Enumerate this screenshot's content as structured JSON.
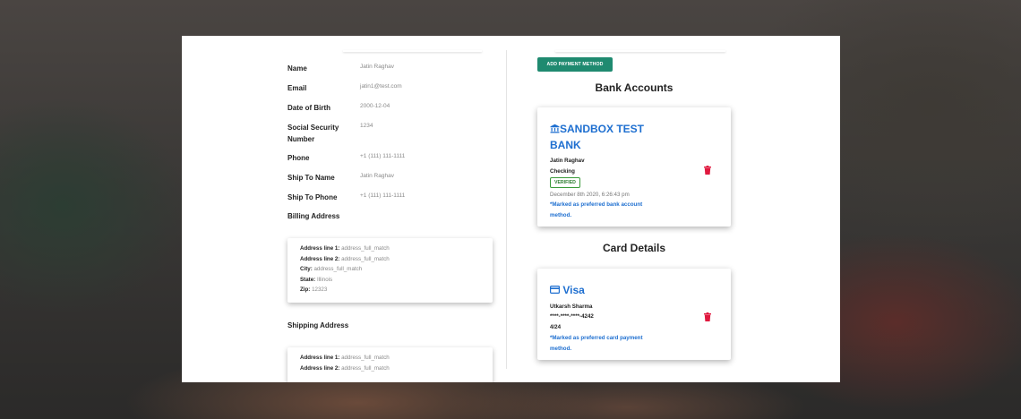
{
  "profile": {
    "fields": [
      {
        "label": "Name",
        "value": "Jatin Raghav"
      },
      {
        "label": "Email",
        "value": "jatin1@test.com"
      },
      {
        "label": "Date of Birth",
        "value": "2000-12-04"
      },
      {
        "label": "Social Security Number",
        "value": "1234"
      },
      {
        "label": "Phone",
        "value": "+1 (111) 111-1111"
      },
      {
        "label": "Ship To Name",
        "value": "Jatin Raghav"
      },
      {
        "label": "Ship To Phone",
        "value": "+1 (111) 111-1111"
      }
    ],
    "billing_label": "Billing Address",
    "billing": {
      "line1_label": "Address line 1:",
      "line1": "address_full_match",
      "line2_label": "Address line 2:",
      "line2": "address_full_match",
      "city_label": "City:",
      "city": "address_full_match",
      "state_label": "State:",
      "state": "Illinois",
      "zip_label": "Zip:",
      "zip": "12323"
    },
    "shipping_label": "Shipping Address",
    "shipping": {
      "line1_label": "Address line 1:",
      "line1": "address_full_match",
      "line2_label": "Address line 2:",
      "line2": "address_full_match"
    }
  },
  "payments": {
    "add_button": "ADD PAYMENT METHOD",
    "bank_heading": "Bank Accounts",
    "bank": {
      "icon": "bank-icon",
      "name_line1": "SANDBOX TEST",
      "name_line2": "BANK",
      "holder": "Jatin Raghav",
      "account_type": "Checking",
      "status": "VERIFIED",
      "date": "December 8th 2020, 6:26:43 pm",
      "note_line1": "*Marked as preferred bank account",
      "note_line2": "method."
    },
    "card_heading": "Card Details",
    "card": {
      "icon": "credit-card-icon",
      "brand": "Visa",
      "holder": "Utkarsh Sharma",
      "number": "****-****-****-4242",
      "expiry": "4/24",
      "note_line1": "*Marked as preferred card payment",
      "note_line2": "method."
    },
    "delete_icon": "trash-icon"
  },
  "colors": {
    "accent_green": "#1f8a70",
    "link_blue": "#1e6fd0",
    "delete_red": "#e0193f",
    "verified_green": "#2e7d32"
  }
}
